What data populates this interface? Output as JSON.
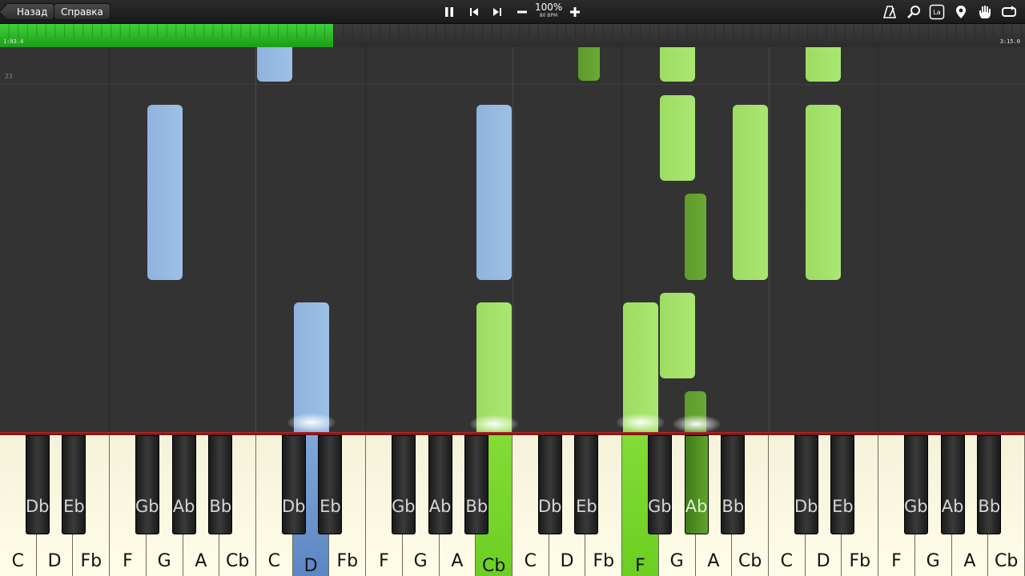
{
  "toolbar": {
    "back_label": "Назад",
    "help_label": "Справка",
    "tempo_percent": "100%",
    "tempo_bpm": "80 BPM",
    "icons": [
      "pause-icon",
      "skip-back-icon",
      "skip-forward-icon",
      "minus-icon",
      "plus-icon",
      "metronome-icon",
      "magnifier-icon",
      "note-label-icon",
      "location-pin-icon",
      "hand-icon",
      "loop-icon"
    ],
    "note_label_badge": "La"
  },
  "progress": {
    "current_time": "1:03.4",
    "total_time": "3:15.0",
    "fraction": 0.325,
    "fill_color": "#2fbf2b"
  },
  "roll": {
    "measure_number": "23",
    "colors": {
      "left_hand": "#9ec0e6",
      "right_hand_light": "#abe673",
      "right_hand_dark": "#6aa935"
    }
  },
  "keyboard": {
    "white_keys": [
      "C",
      "D",
      "Fb",
      "F",
      "G",
      "A",
      "Cb",
      "C",
      "D",
      "Fb",
      "F",
      "G",
      "A",
      "Cb",
      "C",
      "D",
      "Fb",
      "F",
      "G",
      "A",
      "Cb",
      "C",
      "D",
      "Fb",
      "F",
      "G",
      "A",
      "Cb"
    ],
    "black_keys": [
      "Db",
      "Eb",
      "Gb",
      "Ab",
      "Bb",
      "Db",
      "Eb",
      "Gb",
      "Ab",
      "Bb",
      "Db",
      "Eb",
      "Gb",
      "Ab",
      "Bb",
      "Db",
      "Eb",
      "Gb",
      "Ab",
      "Bb"
    ],
    "pressed_white": [
      {
        "index": 8,
        "color": "blue"
      },
      {
        "index": 13,
        "color": "green"
      },
      {
        "index": 17,
        "color": "green"
      }
    ],
    "pressed_black": [
      {
        "index": 13,
        "color": "green"
      }
    ]
  }
}
